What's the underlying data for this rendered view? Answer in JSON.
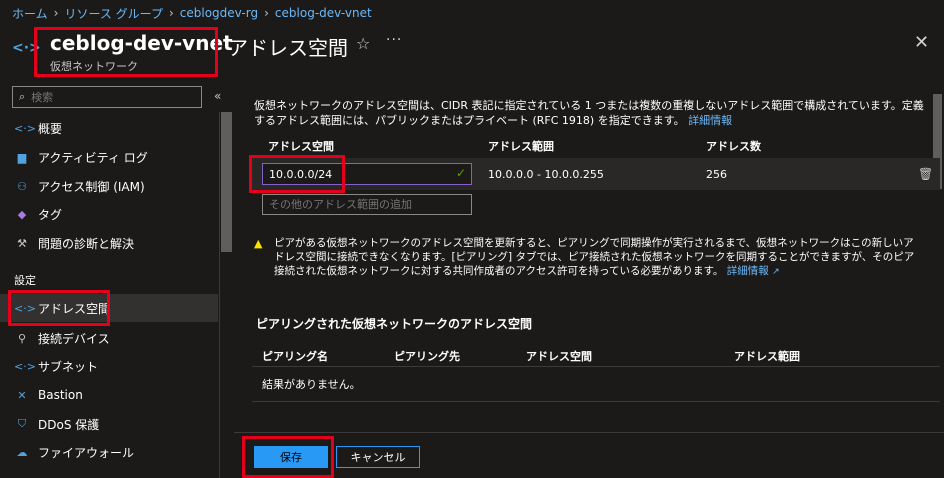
{
  "breadcrumb": [
    "ホーム",
    "リソース グループ",
    "ceblogdev-rg",
    "ceblog-dev-vnet"
  ],
  "resource": {
    "name": "ceblog-dev-vnet",
    "type": "仮想ネットワーク"
  },
  "page_title": "アドレス空間",
  "sidebar": {
    "search_placeholder": "検索",
    "items": [
      {
        "label": "概要",
        "icon": "overview-icon"
      },
      {
        "label": "アクティビティ ログ",
        "icon": "activity-log-icon"
      },
      {
        "label": "アクセス制御 (IAM)",
        "icon": "iam-icon"
      },
      {
        "label": "タグ",
        "icon": "tag-icon"
      },
      {
        "label": "問題の診断と解決",
        "icon": "wrench-icon"
      }
    ],
    "section_settings": "設定",
    "settings_items": [
      {
        "label": "アドレス空間",
        "icon": "address-space-icon"
      },
      {
        "label": "接続デバイス",
        "icon": "plug-icon"
      },
      {
        "label": "サブネット",
        "icon": "subnet-icon"
      },
      {
        "label": "Bastion",
        "icon": "bastion-icon"
      },
      {
        "label": "DDoS 保護",
        "icon": "shield-icon"
      },
      {
        "label": "ファイアウォール",
        "icon": "firewall-icon"
      }
    ]
  },
  "description": {
    "text": "仮想ネットワークのアドレス空間は、CIDR 表記に指定されている 1 つまたは複数の重複しないアドレス範囲で構成されています。定義するアドレス範囲には、パブリックまたはプライベート (RFC 1918) を指定できます。",
    "link": "詳細情報"
  },
  "address_table": {
    "headers": [
      "アドレス空間",
      "アドレス範囲",
      "アドレス数"
    ],
    "row": {
      "address_space": "10.0.0.0/24",
      "address_range": "10.0.0.0 - 10.0.0.255",
      "address_count": "256"
    },
    "add_placeholder": "その他のアドレス範囲の追加"
  },
  "warning": {
    "text": "ピアがある仮想ネットワークのアドレス空間を更新すると、ピアリングで同期操作が実行されるまで、仮想ネットワークはこの新しいアドレス空間に接続できなくなります。[ピアリング] タブでは、ピア接続された仮想ネットワークを同期することができますが、そのピア接続された仮想ネットワークに対する共同作成者のアクセス許可を持っている必要があります。",
    "link": "詳細情報"
  },
  "peering": {
    "title": "ピアリングされた仮想ネットワークのアドレス空間",
    "headers": [
      "ピアリング名",
      "ピアリング先",
      "アドレス空間",
      "アドレス範囲"
    ],
    "empty_text": "結果がありません。"
  },
  "footer": {
    "save_label": "保存",
    "cancel_label": "キャンセル"
  },
  "colors": {
    "accent": "#2899f5",
    "highlight": "#e4001b",
    "warning": "#fce100",
    "valid": "#57a300"
  }
}
